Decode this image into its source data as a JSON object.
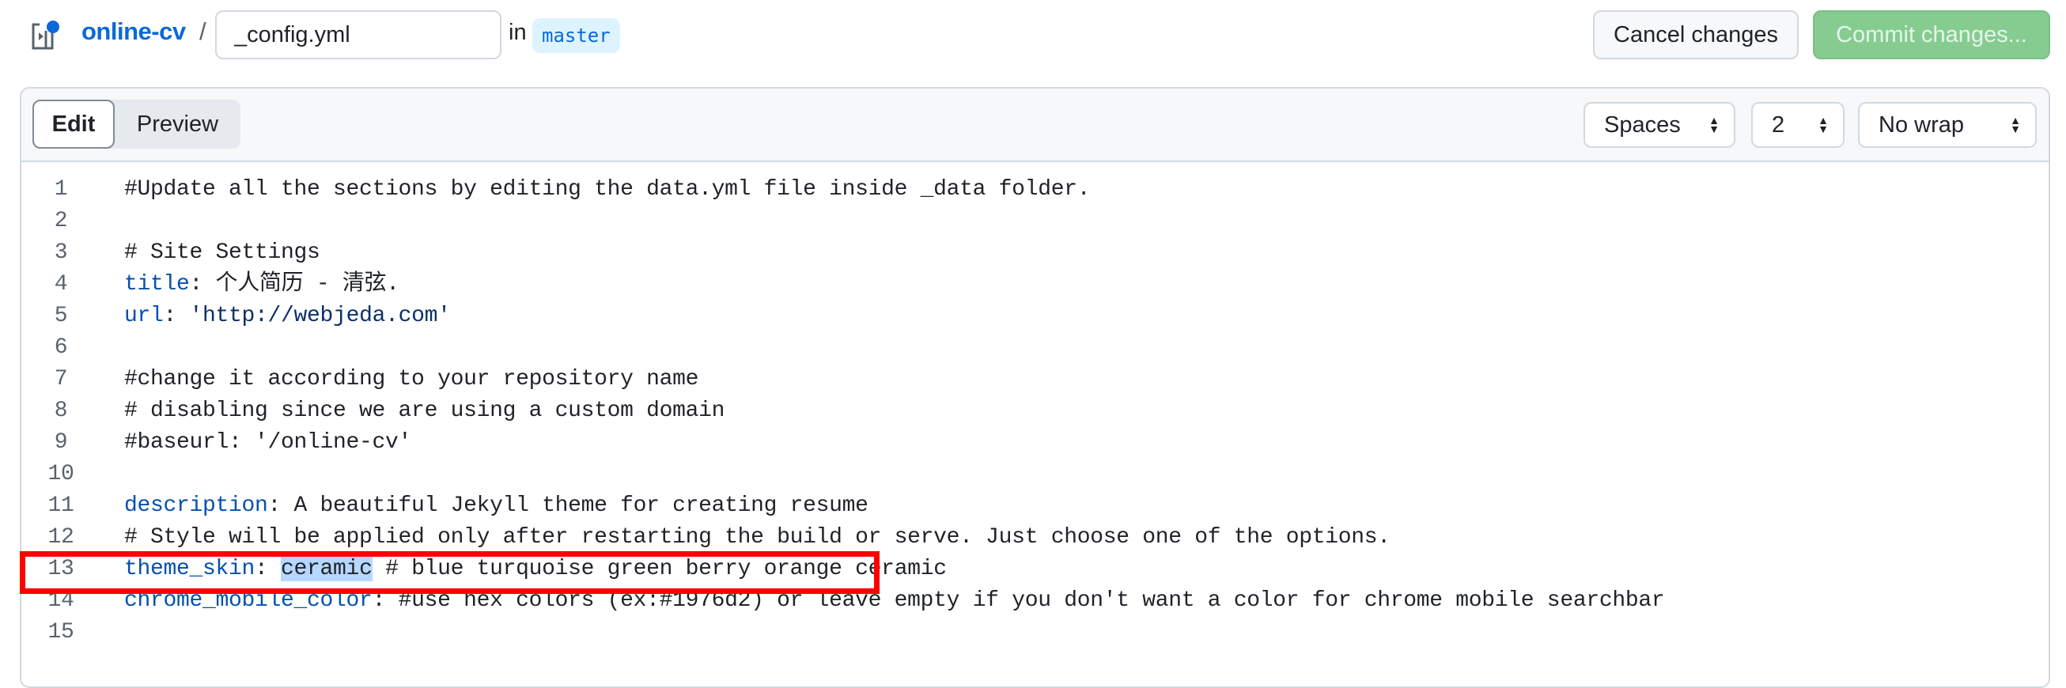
{
  "header": {
    "repo": "online-cv",
    "separator": "/",
    "filename": "_config.yml",
    "in_label": "in",
    "branch": "master",
    "cancel_label": "Cancel changes",
    "commit_label": "Commit changes..."
  },
  "toolbar": {
    "tabs": [
      {
        "label": "Edit",
        "active": true
      },
      {
        "label": "Preview",
        "active": false
      }
    ],
    "indent_mode": "Spaces",
    "indent_size": "2",
    "wrap_mode": "No wrap"
  },
  "colors": {
    "accent": "#0969da",
    "commit": "#86cc91",
    "highlight_box": "#ff0000",
    "selection": "#b6d7ff"
  },
  "code": {
    "lines": [
      {
        "n": "1",
        "parts": [
          {
            "t": "#Update all the sections by editing the data.yml file inside _data folder.",
            "c": ""
          }
        ]
      },
      {
        "n": "2",
        "parts": []
      },
      {
        "n": "3",
        "parts": [
          {
            "t": "# Site Settings",
            "c": ""
          }
        ]
      },
      {
        "n": "4",
        "parts": [
          {
            "t": "title",
            "c": "k"
          },
          {
            "t": ": 个人简历 - 清弦.",
            "c": ""
          }
        ]
      },
      {
        "n": "5",
        "parts": [
          {
            "t": "url",
            "c": "k"
          },
          {
            "t": ": ",
            "c": ""
          },
          {
            "t": "'http://webjeda.com'",
            "c": "s"
          }
        ]
      },
      {
        "n": "6",
        "parts": []
      },
      {
        "n": "7",
        "parts": [
          {
            "t": "#change it according to your repository name",
            "c": ""
          }
        ]
      },
      {
        "n": "8",
        "parts": [
          {
            "t": "# disabling since we are using a custom domain",
            "c": ""
          }
        ]
      },
      {
        "n": "9",
        "parts": [
          {
            "t": "#baseurl: '/online-cv'",
            "c": ""
          }
        ]
      },
      {
        "n": "10",
        "parts": []
      },
      {
        "n": "11",
        "parts": [
          {
            "t": "description",
            "c": "k"
          },
          {
            "t": ": A beautiful Jekyll theme for creating resume",
            "c": ""
          }
        ]
      },
      {
        "n": "12",
        "parts": [
          {
            "t": "# Style will be applied only after restarting the build or serve. Just choose one of the options.",
            "c": ""
          }
        ]
      },
      {
        "n": "13",
        "parts": [
          {
            "t": "theme_skin",
            "c": "k"
          },
          {
            "t": ": ",
            "c": ""
          },
          {
            "t": "ceramic",
            "c": "hl"
          },
          {
            "t": " # blue turquoise green berry orange ceramic",
            "c": ""
          }
        ]
      },
      {
        "n": "14",
        "parts": [
          {
            "t": "chrome_mobile_color",
            "c": "k"
          },
          {
            "t": ": #use hex colors (ex:#1976d2) or leave empty if you don't want a color for chrome mobile searchbar",
            "c": ""
          }
        ]
      },
      {
        "n": "15",
        "parts": []
      }
    ]
  }
}
